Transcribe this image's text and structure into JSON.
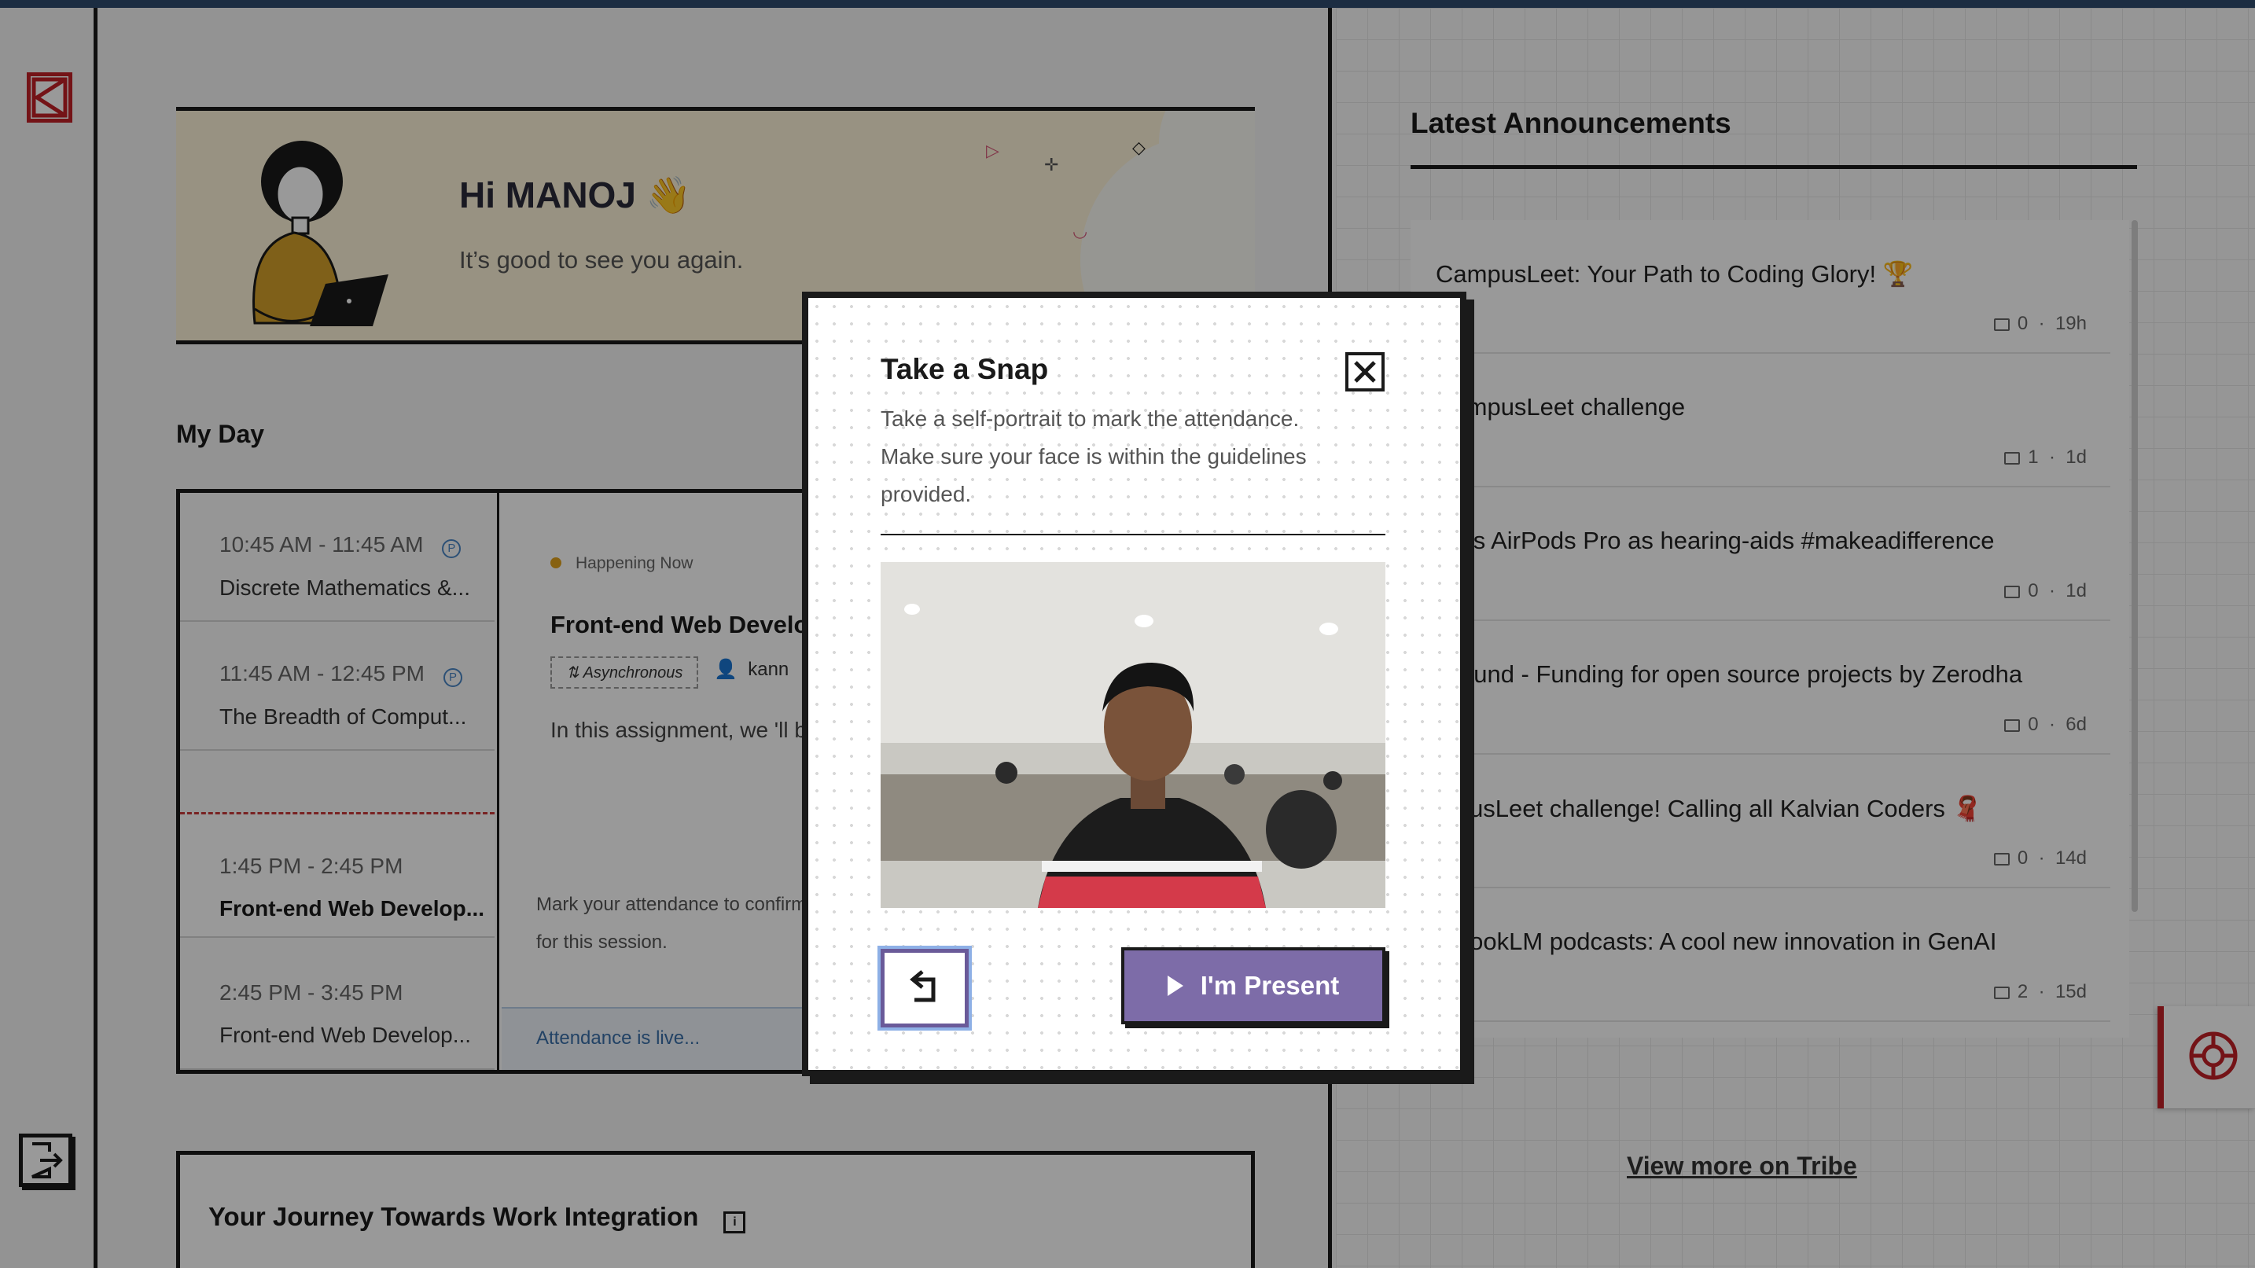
{
  "welcome": {
    "greeting": "Hi MANOJ 👋",
    "subtitle": "It’s good to see you again."
  },
  "my_day": {
    "heading": "My Day",
    "slots": [
      {
        "time": "10:45 AM - 11:45 AM",
        "badge": "P",
        "class_name": "Discrete Mathematics &..."
      },
      {
        "time": "11:45 AM - 12:45 PM",
        "badge": "P",
        "class_name": "The Breadth of Comput..."
      },
      {
        "time": "1:45 PM - 2:45 PM",
        "class_name": "Front-end Web Develop..."
      },
      {
        "time": "2:45 PM - 3:45 PM",
        "class_name": "Front-end Web Develop..."
      }
    ],
    "detail": {
      "status": "Happening Now",
      "title": "Front-end Web Develop",
      "tag": "Asynchronous",
      "instructor": "kann",
      "description": "In this assignment, we 'll b",
      "mark_attendance": "Mark your attendance to confirm presence for this session.",
      "attendance_status": "Attendance is live..."
    }
  },
  "journey": {
    "title": "Your Journey Towards Work Integration"
  },
  "announcements": {
    "heading": "Latest Announcements",
    "items": [
      {
        "title": "CampusLeet: Your Path to Coding Glory! 🏆",
        "comments": "0",
        "age": "19h"
      },
      {
        "title": "CampusLeet challenge",
        "comments": "1",
        "age": "1d"
      },
      {
        "title": "ple’s AirPods Pro as hearing-aids #makeadifference",
        "comments": "0",
        "age": "1d"
      },
      {
        "title": "ss.fund - Funding for open source projects by Zerodha",
        "comments": "0",
        "age": "6d"
      },
      {
        "title": "mpusLeet challenge! Calling all Kalvian Coders 🧣",
        "comments": "0",
        "age": "14d"
      },
      {
        "title": "tebookLM podcasts: A cool new innovation in GenAI",
        "comments": "2",
        "age": "15d"
      }
    ],
    "view_more": "View more on Tribe"
  },
  "modal": {
    "title": "Take a Snap",
    "description": "Take a self-portrait to mark the attendance. Make sure your face is within the guidelines provided.",
    "present_button": "I'm Present"
  },
  "colors": {
    "accent_purple": "#7d6ca8",
    "brand_red": "#c22127",
    "happening_dot": "#e2a21c",
    "link_blue": "#3a6fa8"
  },
  "icons": {
    "logo": "kalvium-logo-icon",
    "logout": "logout-icon",
    "close": "close-icon",
    "retake": "retake-icon",
    "play": "play-icon",
    "help": "lifebuoy-icon",
    "comment": "comment-icon"
  }
}
